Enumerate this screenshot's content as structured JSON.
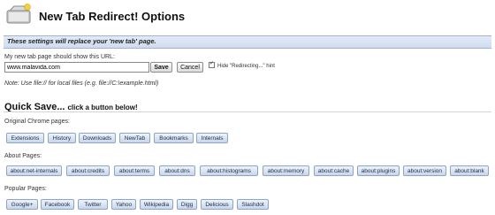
{
  "header": {
    "title": "New Tab Redirect! Options"
  },
  "banner": {
    "text": "These settings will replace your 'new tab' page."
  },
  "url": {
    "label": "My new tab page should show this URL:",
    "value": "www.malavida.com",
    "save_label": "Save",
    "cancel_label": "Cancel",
    "hint_label": "Hide \"Redirecting...\" hint",
    "hint_checked": true,
    "note": "Note: Use file:// for local files (e.g. file://C:\\example.html)"
  },
  "quick_save": {
    "title": "Quick Save...",
    "subtitle": "click a button below!"
  },
  "sections": [
    {
      "label": "Original Chrome pages:",
      "buttons": [
        "Extensions",
        "History",
        "Downloads",
        "NewTab",
        "Bookmarks",
        "Internals"
      ]
    },
    {
      "label": "About Pages:",
      "buttons": [
        "about:net-internals",
        "about:credits",
        "about:terms",
        "about:dns",
        "about:histograms",
        "about:memory",
        "about:cache",
        "about:plugins",
        "about:version",
        "about:blank"
      ]
    },
    {
      "label": "Popular Pages:",
      "buttons": [
        "Google+",
        "Facebook",
        "Twitter",
        "Yahoo",
        "Wikipedia",
        "Digg",
        "Delicious",
        "Slashdot"
      ]
    }
  ]
}
